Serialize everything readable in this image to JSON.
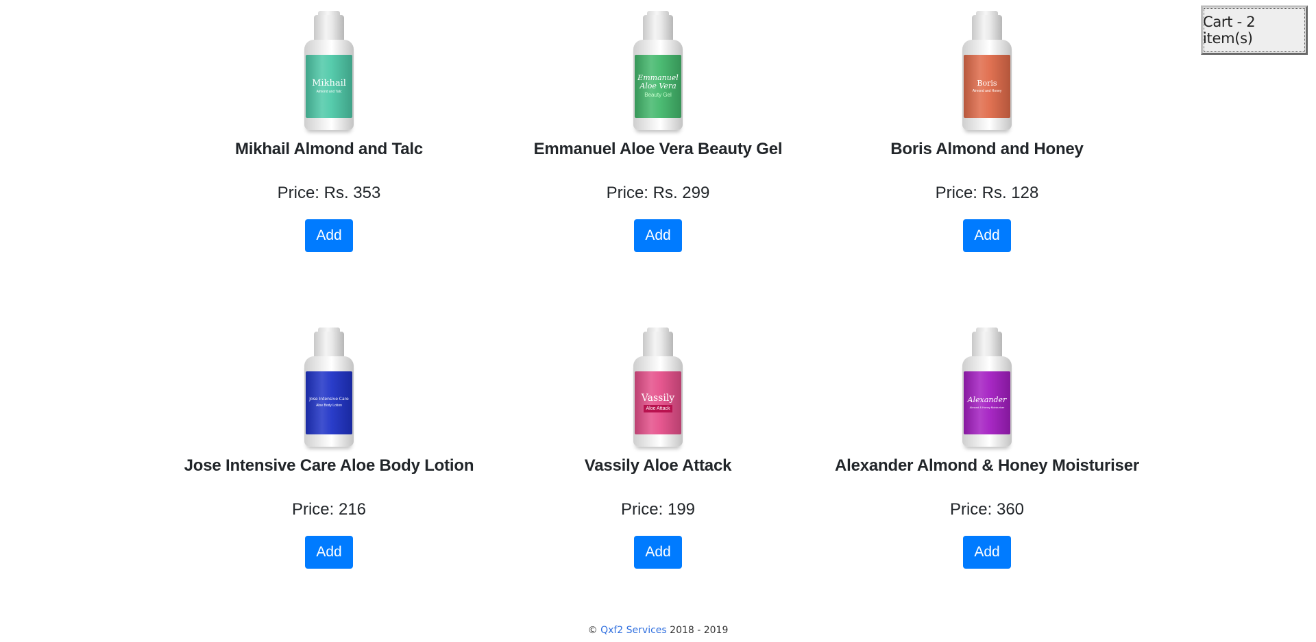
{
  "cart": {
    "label": "Cart - 2 item(s)"
  },
  "products": [
    {
      "name": "Mikhail Almond and Talc",
      "price": "Price: Rs. 353",
      "button": "Add",
      "label_brand": "Mikhail",
      "label_sub": "Almond and Talc",
      "color": "#4ec9a8"
    },
    {
      "name": "Emmanuel Aloe Vera Beauty Gel",
      "price": "Price: Rs. 299",
      "button": "Add",
      "label_brand": "Emmanuel Aloe Vera",
      "label_sub": "Beauty Gel",
      "color": "#43b86c"
    },
    {
      "name": "Boris Almond and Honey",
      "price": "Price: Rs. 128",
      "button": "Add",
      "label_brand": "Boris",
      "label_sub": "Almond and Honey",
      "color": "#e06b4a"
    },
    {
      "name": "Jose Intensive Care Aloe Body Lotion",
      "price": "Price: 216",
      "button": "Add",
      "label_brand": "Jose Intensive Care",
      "label_sub": "Aloe Body Lotion",
      "color": "#1f33c7"
    },
    {
      "name": "Vassily Aloe Attack",
      "price": "Price: 199",
      "button": "Add",
      "label_brand": "Vassily",
      "label_sub": "Aloe Attack",
      "color": "#e54f8a"
    },
    {
      "name": "Alexander Almond & Honey Moisturiser",
      "price": "Price: 360",
      "button": "Add",
      "label_brand": "Alexander",
      "label_sub": "Almond & Honey Moisturiser",
      "color": "#a41ec2"
    }
  ],
  "footer": {
    "copyright": "©",
    "link": "Qxf2 Services",
    "years": "2018 - 2019"
  },
  "colors": {
    "accent": "#007bff",
    "link": "#2f6fdf"
  }
}
